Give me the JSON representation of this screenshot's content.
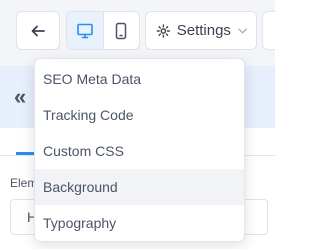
{
  "toolbar": {
    "back_icon": "arrow-left-icon",
    "desktop_icon": "monitor-icon",
    "mobile_icon": "smartphone-icon",
    "settings_icon": "gear-icon",
    "settings_label": "Settings",
    "chevron_icon": "chevron-down-icon",
    "active_color": "#2d8cf0"
  },
  "panel": {
    "collapse_icon": "double-chevron-left-icon",
    "element_label": "Elem",
    "element_input_value": "H"
  },
  "settings_menu": {
    "items": [
      {
        "label": "SEO Meta Data"
      },
      {
        "label": "Tracking Code"
      },
      {
        "label": "Custom CSS"
      },
      {
        "label": "Background",
        "hovered": true
      },
      {
        "label": "Typography"
      }
    ]
  }
}
